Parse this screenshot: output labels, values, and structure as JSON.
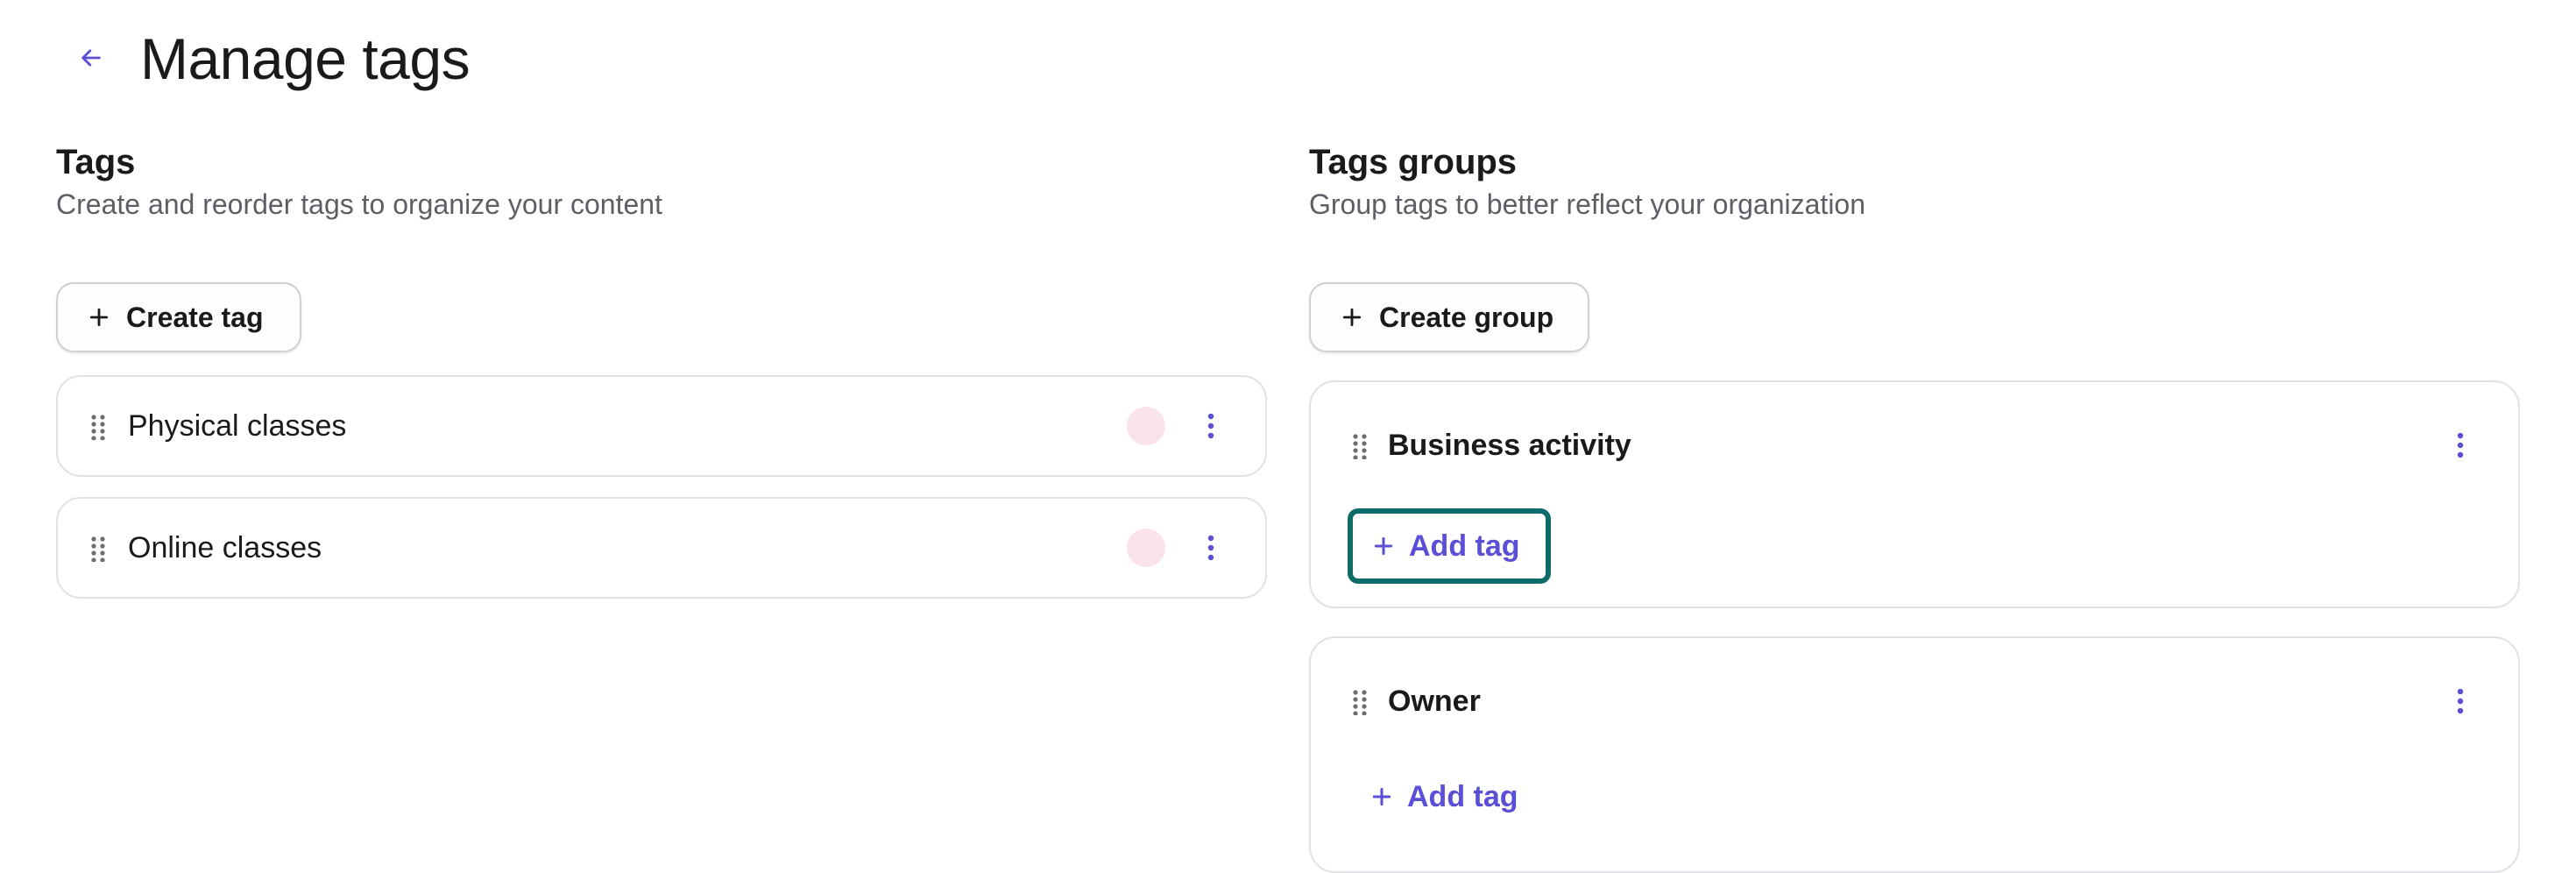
{
  "header": {
    "title": "Manage tags"
  },
  "tags": {
    "title": "Tags",
    "subtitle": "Create and reorder tags to organize your content",
    "create_label": "Create tag",
    "items": [
      {
        "label": "Physical classes",
        "color": "#fbe3ec"
      },
      {
        "label": "Online classes",
        "color": "#fbe3ec"
      }
    ]
  },
  "groups": {
    "title": "Tags groups",
    "subtitle": "Group tags to better reflect your organization",
    "create_label": "Create group",
    "items": [
      {
        "title": "Business activity",
        "add_label": "Add tag"
      },
      {
        "title": "Owner",
        "add_label": "Add tag"
      }
    ]
  },
  "colors": {
    "accent": "#5b4fd6",
    "focus_ring": "#0f6b67",
    "border": "#e2e2e6"
  }
}
